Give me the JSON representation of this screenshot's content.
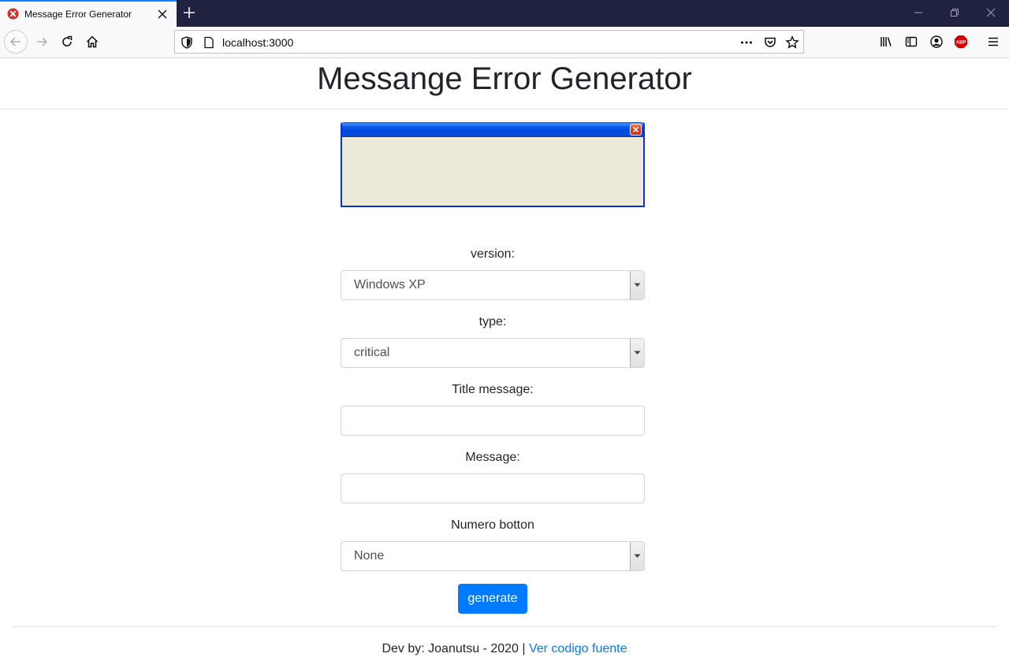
{
  "browser": {
    "tab_title": "Message Error Generator",
    "url": "localhost:3000",
    "colors": {
      "tabbar": "#202340",
      "accent": "#0a84ff"
    },
    "icons": [
      "error-favicon-icon",
      "close-icon",
      "plus-icon",
      "minimize-icon",
      "restore-icon",
      "window-close-icon",
      "back-icon",
      "forward-icon",
      "reload-icon",
      "home-icon",
      "shield-icon",
      "page-icon",
      "more-icon",
      "pocket-icon",
      "bookmark-star-icon",
      "library-icon",
      "sidebar-icon",
      "account-icon",
      "adblock-icon",
      "menu-icon"
    ],
    "adblock_label": "ABP"
  },
  "page": {
    "title": "Messange Error Generator"
  },
  "preview": {
    "style": "Windows XP",
    "colors": {
      "titlebar": "#0054e3",
      "body": "#ece9d8",
      "close": "#d2431e"
    }
  },
  "form": {
    "version_label": "version:",
    "version_value": "Windows XP",
    "type_label": "type:",
    "type_value": "critical",
    "title_label": "Title message:",
    "title_value": "",
    "message_label": "Message:",
    "message_value": "",
    "buttons_label": "Numero botton",
    "buttons_value": "None",
    "generate_label": "generate",
    "colors": {
      "primary": "#007bff"
    }
  },
  "footer": {
    "text": "Dev by: Joanutsu - 2020 |",
    "link": "Ver codigo fuente"
  }
}
